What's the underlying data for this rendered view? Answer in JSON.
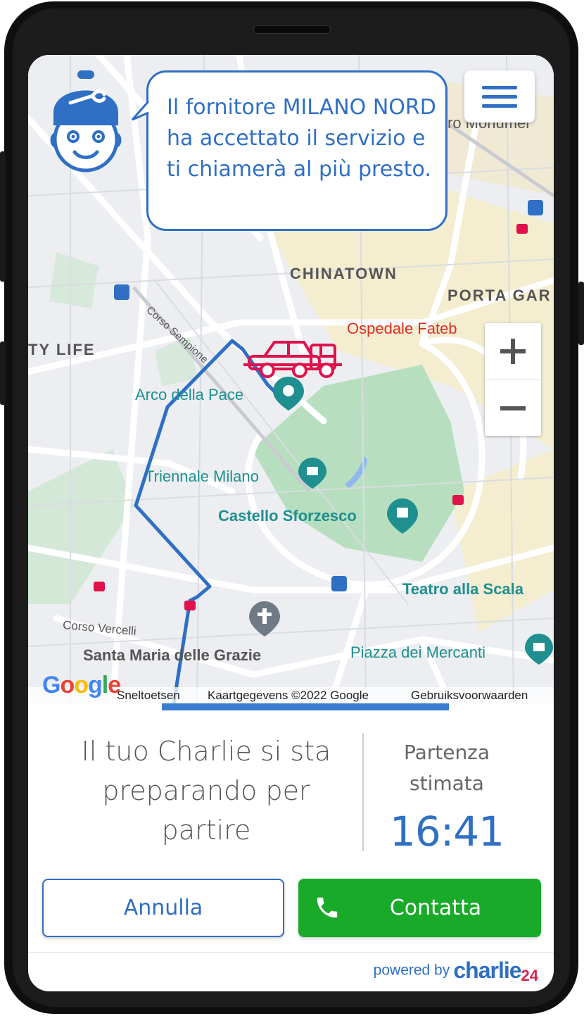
{
  "map": {
    "labels": {
      "chinatown": "CHINATOWN",
      "porta_garibaldi": "PORTA GAR",
      "ospedale": "Ospedale Fateb",
      "ty_life": "TY LIFE",
      "corso_sempione": "Corso Sempione",
      "arco_della_pace": "Arco della Pace",
      "triennale": "Triennale Milano",
      "castello": "Castello Sforzesco",
      "teatro": "Teatro alla Scala",
      "corso_vercelli": "Corso Vercelli",
      "santa_maria": "Santa Maria delle Grazie",
      "piazza_mercanti": "Piazza dei Mercanti",
      "monumentale": "ro Monumer"
    },
    "attribution": {
      "logo": "Google",
      "shortcuts": "Sneltoetsen",
      "map_data": "Kaartgegevens ©2022 Google",
      "terms": "Gebruiksvoorwaarden"
    },
    "zoom_in_icon": "plus-icon",
    "zoom_out_icon": "minus-icon",
    "vehicle_icon": "tow-truck-icon",
    "colors": {
      "route": "#2f6fc4",
      "vehicle": "#e0114b",
      "park": "#b7dfbf"
    }
  },
  "header": {
    "menu_icon": "hamburger-menu-icon",
    "assistant_icon": "mechanic-avatar-icon",
    "message": "Il fornitore MILANO NORD ha accettato il servizio e ti chiamerà al più presto."
  },
  "status": {
    "message": "Il tuo Charlie si sta preparando per partire",
    "eta_label": "Partenza stimata",
    "eta_time": "16:41"
  },
  "actions": {
    "cancel_label": "Annulla",
    "contact_label": "Contatta",
    "contact_icon": "phone-icon",
    "contact_color": "#1aaa2a"
  },
  "footer": {
    "powered_by": "powered by",
    "brand": "charlie",
    "brand_number": "24"
  }
}
